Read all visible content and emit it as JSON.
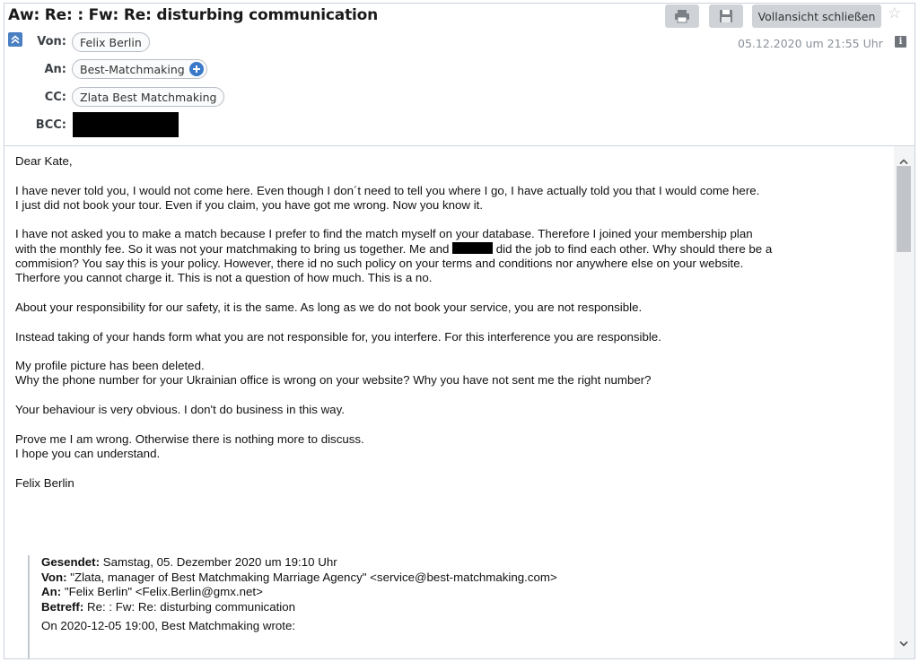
{
  "header": {
    "subject": "Aw: Re: : Fw: Re: disturbing communication",
    "close_full_view_label": "Vollansicht schließen",
    "icons": {
      "print": "printer-icon",
      "save": "floppy-disk-icon",
      "star": "star-icon",
      "collapse": "chevron-up-icon",
      "info": "info-icon"
    },
    "from_label": "Von:",
    "from_value": "Felix Berlin",
    "to_label": "An:",
    "to_value": "Best-Matchmaking",
    "cc_label": "CC:",
    "cc_value": "Zlata Best Matchmaking",
    "bcc_label": "BCC:",
    "date": "05.12.2020 um 21:55 Uhr",
    "info_glyph": "i"
  },
  "body": {
    "greeting": "Dear Kate,",
    "para1": "I have never told you, I would not come here. Even though I don´t need to tell you where I go, I have actually told you that I would come here.\nI just did not book your tour. Even if you claim, you have got me wrong. Now you know it.",
    "para2_before": "I have not asked you to make a match because I prefer to find the match myself on your database. Therefore I joined your membership plan\nwith the monthly fee. So it was not your matchmaking to bring us together. Me and ",
    "para2_after": " did the job to find each other. Why should there be a\ncommision? You say this is your policy. However, there id no such policy on your terms and conditions nor anywhere else on your website.\nTherfore you cannot charge it. This is not a question of how much. This is a no.",
    "para3": "About your responsibility for our safety, it is the same. As long as we do not book your service, you are not responsible.",
    "para4": "Instead taking of your hands form what you are not responsible for, you interfere. For this interference you are responsible.",
    "para5": "My profile picture has been deleted.\nWhy the phone number for your Ukrainian office is wrong on your website? Why you have not sent me the right number?",
    "para6": "Your behaviour is very obvious. I don't do business in this way.",
    "para7": "Prove me I am wrong. Otherwise there is nothing more to discuss.\nI hope you can understand.",
    "signature": "Felix Berlin"
  },
  "quote": {
    "sent_label": "Gesendet:",
    "sent_value": "Samstag, 05. Dezember 2020 um 19:10 Uhr",
    "from_label": "Von:",
    "from_value": "\"Zlata, manager of Best Matchmaking Marriage Agency\" <service@best-matchmaking.com>",
    "to_label": "An:",
    "to_value": "\"Felix Berlin\" <Felix.Berlin@gmx.net>",
    "subject_label": "Betreff:",
    "subject_value": "Re: : Fw: Re: disturbing communication",
    "wrote_line": "On 2020-12-05 19:00, Best Matchmaking wrote:"
  },
  "colors": {
    "accent": "#3a78c9",
    "toolbar_button": "#cfd3d8",
    "date_text": "#8a9099"
  }
}
